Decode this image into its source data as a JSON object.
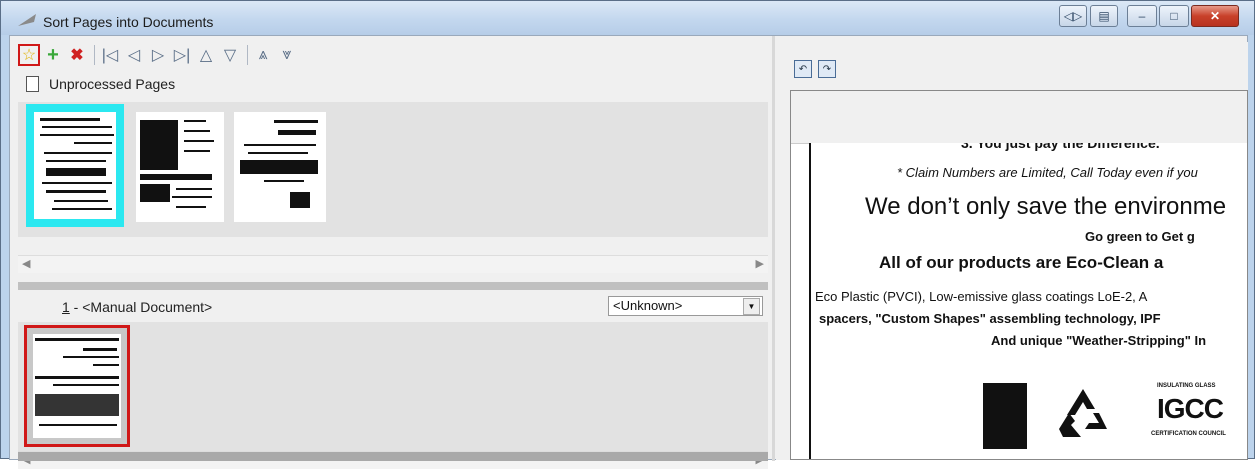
{
  "window": {
    "title": "Sort Pages into Documents"
  },
  "toolbar": {
    "buttons": [
      "favorite-star",
      "add",
      "delete",
      "first",
      "previous",
      "next",
      "last",
      "up",
      "down",
      "move-top",
      "move-bottom"
    ]
  },
  "unprocessed": {
    "label": "Unprocessed Pages"
  },
  "document": {
    "number": "1",
    "separator": " - ",
    "name": "<Manual Document>",
    "type_value": "<Unknown>"
  },
  "preview": {
    "line1": "3. You just pay the Difference.",
    "line2": "* Claim Numbers are Limited, Call Today even if you",
    "line3": "We don’t only save the environme",
    "line4": "Go green to Get g",
    "line5": "All of our products are Eco-Clean a",
    "line6": "Eco Plastic (PVCI), Low-emissive glass coatings LoE-2, A",
    "line7": "spacers, \"Custom Shapes\" assembling technology, IPF",
    "line8": "And unique \"Weather-Stripping\" In",
    "logo3_top": "INSULATING GLASS",
    "logo3_main": "IGCC",
    "logo3_bottom": "CERTIFICATION COUNCIL"
  },
  "colors": {
    "selection": "#2be8f0",
    "highlight": "#d01818",
    "accent": "#bcd3ec"
  }
}
